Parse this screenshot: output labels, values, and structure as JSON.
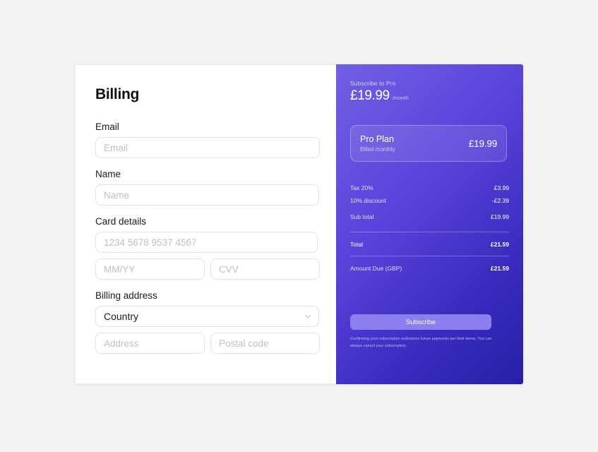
{
  "billing": {
    "title": "Billing",
    "fields": {
      "email": {
        "label": "Email",
        "placeholder": "Email",
        "value": ""
      },
      "name": {
        "label": "Name",
        "placeholder": "Name",
        "value": ""
      },
      "card_details": {
        "label": "Card details",
        "number_placeholder": "1234 5678 9537 4567",
        "number_value": "",
        "expiry_placeholder": "MM/YY",
        "expiry_value": "",
        "cvv_placeholder": "CVV",
        "cvv_value": ""
      },
      "billing_address": {
        "label": "Billing address",
        "country_selected": "Country",
        "address_placeholder": "Address",
        "address_value": "",
        "postal_placeholder": "Postal code",
        "postal_value": ""
      }
    }
  },
  "summary": {
    "eyebrow": "Subscribe to Pro",
    "price": "£19.99",
    "period": "/month",
    "plan": {
      "name": "Pro Plan",
      "billing_cycle": "Billed monthly",
      "price": "£19.99"
    },
    "line_items": [
      {
        "label": "Tax 20%",
        "value": "£3.99"
      },
      {
        "label": "10% discount",
        "value": "-£2.39"
      },
      {
        "label": "Sub total",
        "value": "£19.99"
      }
    ],
    "total": {
      "label": "Total",
      "value": "£21.59"
    },
    "amount_due": {
      "label": "Amount Due (GBP)",
      "value": "£21.59"
    },
    "subscribe_label": "Subscribe",
    "fine_print": "Confirming your subscription authorizes future payments per their terms. You can always cancel your subscription."
  },
  "colors": {
    "page_background": "#f2f2f2",
    "panel_gradient_start": "#6f61e4",
    "panel_gradient_end": "#2620a6",
    "subscribe_button": "#8b7ff0",
    "input_border": "#e3e3e7",
    "placeholder": "#bfbfc6"
  }
}
